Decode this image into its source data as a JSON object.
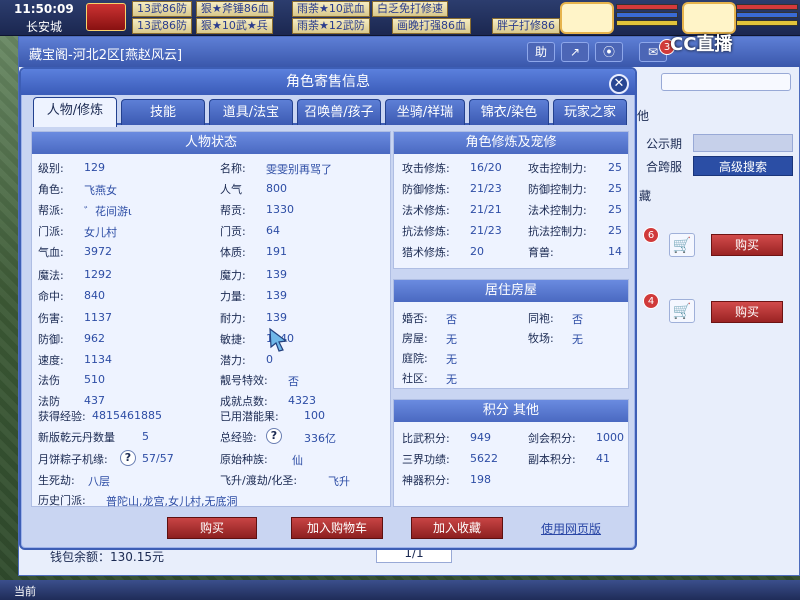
{
  "hud": {
    "time": "11:50:09",
    "location": "长安城",
    "scrolls": [
      "13武86防",
      "狠★斧锤86血",
      "雨荼★10武血",
      "白乏免打修速",
      "13武86防",
      "狠★10武★兵",
      "雨荼★12武防",
      "画晚打强86血",
      "胖子打修86"
    ],
    "logo": "CC直播",
    "bottom_left": "当前",
    "notify_count": "3"
  },
  "store": {
    "title": "藏宝阁-河北2区[燕赵风云]",
    "buttons": [
      "助",
      "↗",
      "⦿"
    ],
    "pub_label": "公示期",
    "cross_label": "合跨服",
    "adv_search": "高级搜索",
    "side_tab": "他",
    "side_collect": "藏",
    "badge1": "6",
    "badge2": "4",
    "buy1": "购买",
    "buy2": "购买",
    "wallet": "钱包余额：130.15元",
    "page": "1/1"
  },
  "dialog": {
    "title": "角色寄售信息",
    "close": "✕",
    "tabs": [
      "人物/修炼",
      "技能",
      "道具/法宝",
      "召唤兽/孩子",
      "坐骑/祥瑞",
      "锦衣/染色",
      "玩家之家"
    ],
    "status": {
      "head": "人物状态",
      "left": [
        {
          "k": "级别:",
          "v": "129"
        },
        {
          "k": "角色:",
          "v": "飞燕女"
        },
        {
          "k": "帮派:",
          "v": "゛花间游ι"
        },
        {
          "k": "门派:",
          "v": "女儿村"
        },
        {
          "k": "气血:",
          "v": "3972"
        },
        {
          "k": "魔法:",
          "v": "1292"
        },
        {
          "k": "命中:",
          "v": "840"
        },
        {
          "k": "伤害:",
          "v": "1137"
        },
        {
          "k": "防御:",
          "v": "962"
        },
        {
          "k": "速度:",
          "v": "1134"
        },
        {
          "k": "法伤",
          "v": "510"
        },
        {
          "k": "法防",
          "v": "437"
        }
      ],
      "right": [
        {
          "k": "名称:",
          "v": "雯雯别再骂了"
        },
        {
          "k": "人气",
          "v": "800"
        },
        {
          "k": "帮贡:",
          "v": "1330"
        },
        {
          "k": "门贡:",
          "v": "64"
        },
        {
          "k": "体质:",
          "v": "191"
        },
        {
          "k": "魔力:",
          "v": "139"
        },
        {
          "k": "力量:",
          "v": "139"
        },
        {
          "k": "耐力:",
          "v": "139"
        },
        {
          "k": "敏捷:",
          "v": "1040"
        },
        {
          "k": "潜力:",
          "v": "0"
        },
        {
          "k": "靓号特效:",
          "v": "否"
        },
        {
          "k": "成就点数:",
          "v": "4323"
        }
      ],
      "exp_label": "获得经验:",
      "exp": "4815461885",
      "used_label": "已用潜能果:",
      "used": "100",
      "qian_label": "新版乾元丹数量",
      "qian": "5",
      "total_label": "总经验:",
      "total": "336亿",
      "zong_label": "月饼粽子机缘:",
      "zong": "57/57",
      "race_label": "原始种族:",
      "race": "仙",
      "death_label": "生死劫:",
      "death": "八层",
      "fly_label": "飞升/渡劫/化圣:",
      "fly": "飞升",
      "history_label": "历史门派:",
      "history": "普陀山,龙宫,女儿村,无底洞"
    },
    "cultivation": {
      "head": "角色修炼及宠修",
      "rows": [
        {
          "k1": "攻击修炼:",
          "v1": "16/20",
          "k2": "攻击控制力:",
          "v2": "25"
        },
        {
          "k1": "防御修炼:",
          "v1": "21/23",
          "k2": "防御控制力:",
          "v2": "25"
        },
        {
          "k1": "法术修炼:",
          "v1": "21/21",
          "k2": "法术控制力:",
          "v2": "25"
        },
        {
          "k1": "抗法修炼:",
          "v1": "21/23",
          "k2": "抗法控制力:",
          "v2": "25"
        },
        {
          "k1": "猎术修炼:",
          "v1": "20",
          "k2": "育兽:",
          "v2": "14"
        }
      ]
    },
    "house": {
      "head": "居住房屋",
      "rows": [
        {
          "k1": "婚否:",
          "v1": "否",
          "k2": "同袍:",
          "v2": "否"
        },
        {
          "k1": "房屋:",
          "v1": "无",
          "k2": "牧场:",
          "v2": "无"
        },
        {
          "k1": "庭院:",
          "v1": "无",
          "k2": "",
          "v2": ""
        },
        {
          "k1": "社区:",
          "v1": "无",
          "k2": "",
          "v2": ""
        }
      ]
    },
    "points": {
      "head": "积分 其他",
      "rows": [
        {
          "k1": "比武积分:",
          "v1": "949",
          "k2": "剑会积分:",
          "v2": "1000"
        },
        {
          "k1": "三界功绩:",
          "v1": "5622",
          "k2": "副本积分:",
          "v2": "41"
        },
        {
          "k1": "神器积分:",
          "v1": "198",
          "k2": "",
          "v2": ""
        }
      ]
    },
    "actions": {
      "buy": "购买",
      "add_cart": "加入购物车",
      "add_fav": "加入收藏",
      "web": "使用网页版"
    },
    "help": "?"
  }
}
